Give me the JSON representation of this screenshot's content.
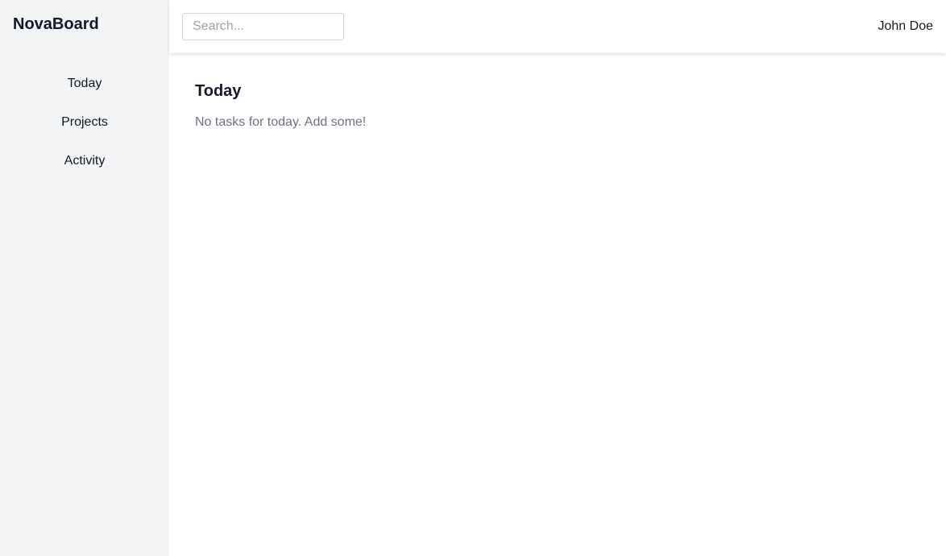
{
  "app": {
    "brand": "NovaBoard"
  },
  "sidebar": {
    "items": [
      {
        "label": "Today"
      },
      {
        "label": "Projects"
      },
      {
        "label": "Activity"
      }
    ]
  },
  "header": {
    "search": {
      "placeholder": "Search...",
      "value": ""
    },
    "user_name": "John Doe"
  },
  "main": {
    "title": "Today",
    "empty_message": "No tasks for today. Add some!"
  },
  "colors": {
    "sidebar_bg": "#f3f4f6",
    "text_primary": "#111827",
    "text_muted": "#6b7280"
  }
}
